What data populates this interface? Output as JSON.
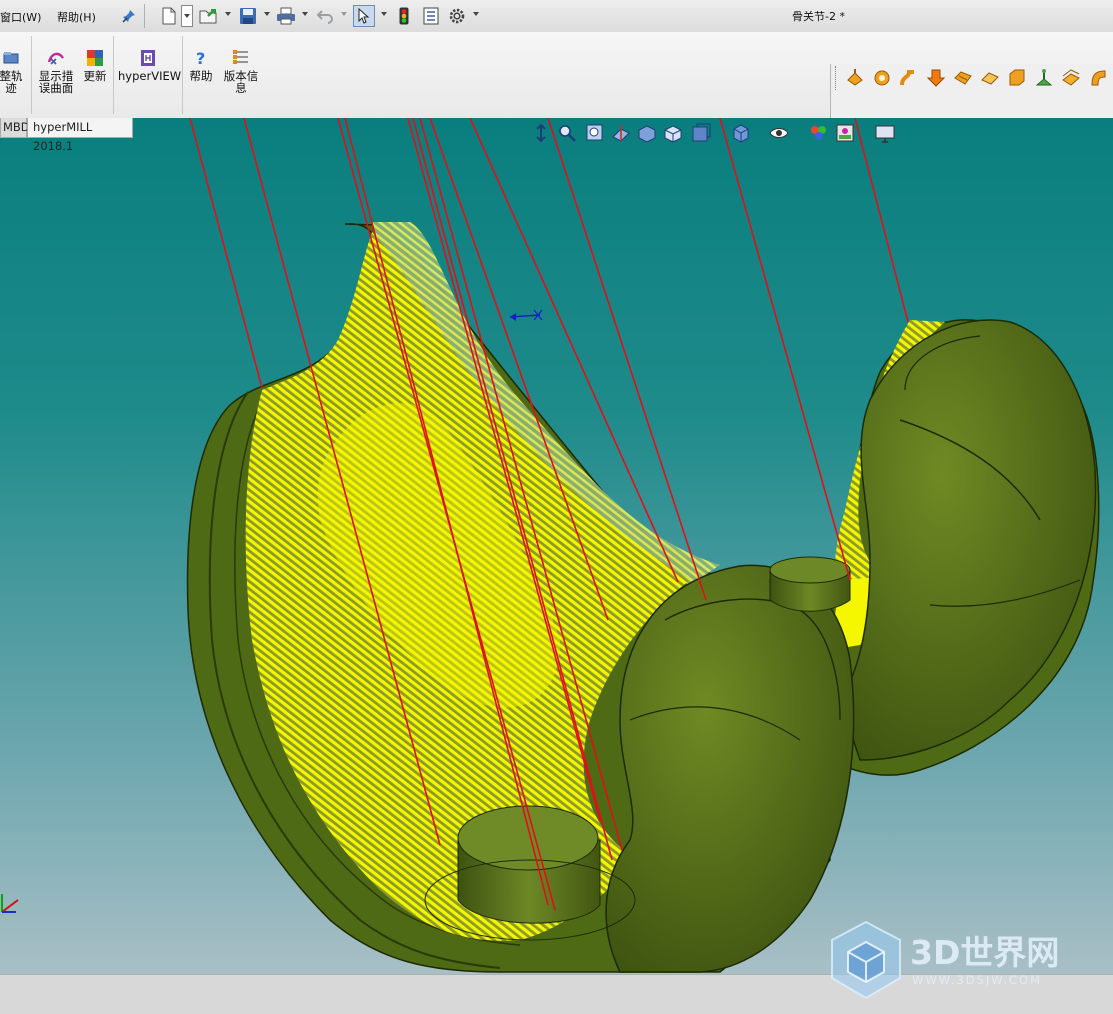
{
  "menu": {
    "window_label": "窗口(W)",
    "help_label": "帮助(H)"
  },
  "document": {
    "title": "骨关节-2 *"
  },
  "ribbon": {
    "buttons": [
      {
        "label": "整轨\n迹",
        "icon": "toolpath-icon"
      },
      {
        "label": "显示措\n误曲面",
        "icon": "error-surface-icon"
      },
      {
        "label": "更新",
        "icon": "update-icon"
      },
      {
        "label": "hyperVIEW",
        "icon": "hyperview-icon"
      },
      {
        "label": "帮助",
        "icon": "help-icon"
      },
      {
        "label": "版本信\n息",
        "icon": "version-info-icon"
      }
    ]
  },
  "tabs": [
    {
      "label": "MBD"
    },
    {
      "label": "hyperMILL 2018.1"
    }
  ],
  "watermark": {
    "title": "3D世界网",
    "url": "WWW.3DSJW.COM"
  },
  "colors": {
    "viewport_top": "#0a7e7e",
    "part_green": "#5a7419",
    "toolpath_yellow": "#f4f700",
    "rapid_red": "#e0101a"
  }
}
